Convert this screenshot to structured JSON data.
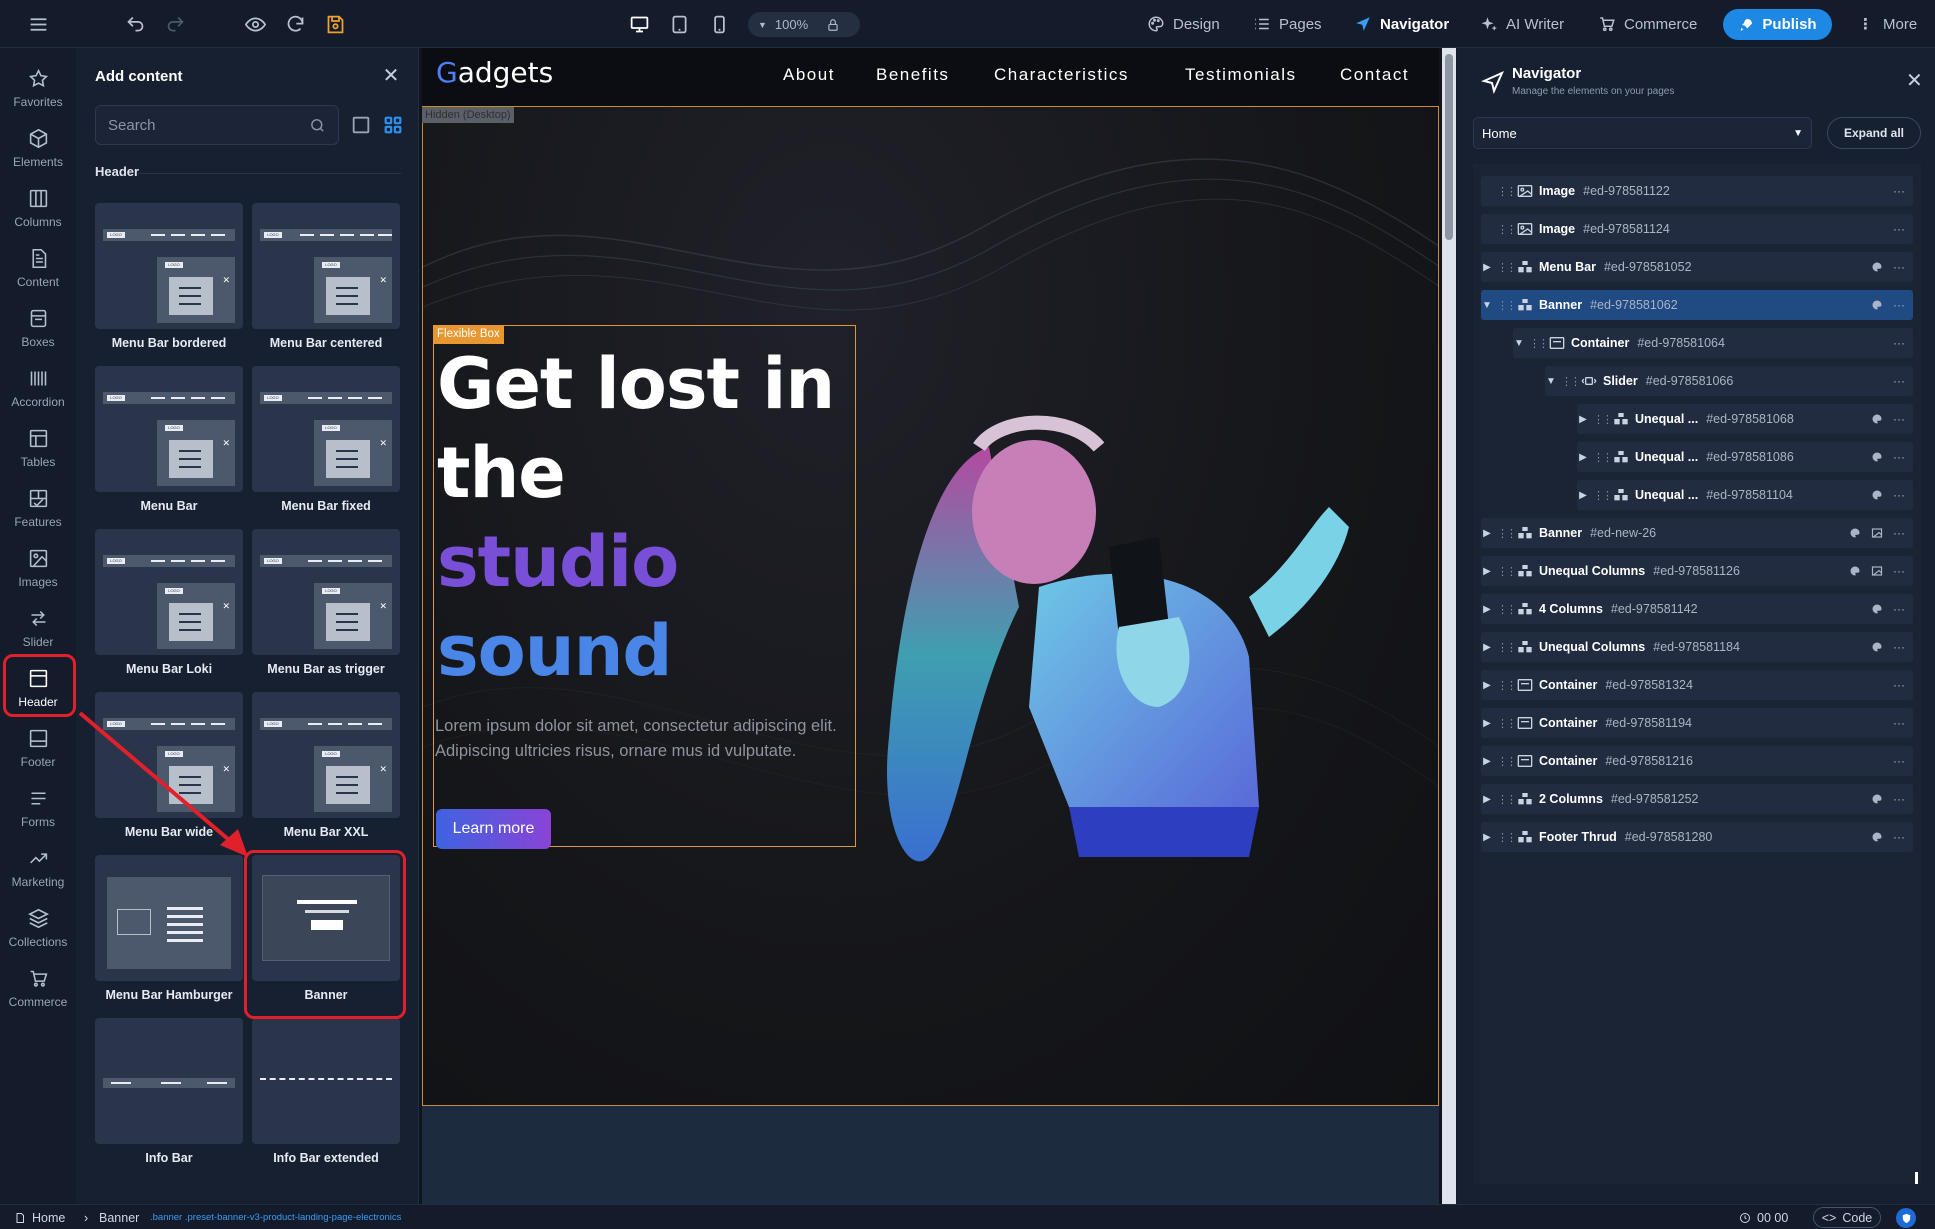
{
  "topbar": {
    "menu_icon": "hamburger-icon",
    "undo_icon": "undo-icon",
    "redo_icon": "redo-icon",
    "preview_icon": "eye-icon",
    "refresh_icon": "refresh-icon",
    "save_icon": "save-icon",
    "zoom": "100%",
    "devices": [
      "desktop",
      "tablet",
      "mobile"
    ],
    "links": [
      {
        "label": "Design",
        "icon": "palette-icon"
      },
      {
        "label": "Pages",
        "icon": "list-icon"
      },
      {
        "label": "Navigator",
        "icon": "navigator-icon",
        "active": true
      },
      {
        "label": "AI Writer",
        "icon": "sparkle-icon"
      },
      {
        "label": "Commerce",
        "icon": "cart-icon"
      }
    ],
    "publish_label": "Publish",
    "more_label": "More"
  },
  "rail": [
    {
      "label": "Favorites",
      "icon": "star-icon"
    },
    {
      "label": "Elements",
      "icon": "cube-icon"
    },
    {
      "label": "Columns",
      "icon": "columns-icon"
    },
    {
      "label": "Content",
      "icon": "document-icon"
    },
    {
      "label": "Boxes",
      "icon": "box-icon"
    },
    {
      "label": "Accordion",
      "icon": "accordion-icon"
    },
    {
      "label": "Tables",
      "icon": "table-icon"
    },
    {
      "label": "Features",
      "icon": "features-icon"
    },
    {
      "label": "Images",
      "icon": "image-icon"
    },
    {
      "label": "Slider",
      "icon": "slider-icon"
    },
    {
      "label": "Header",
      "icon": "header-icon",
      "active": true
    },
    {
      "label": "Footer",
      "icon": "footer-icon"
    },
    {
      "label": "Forms",
      "icon": "forms-icon"
    },
    {
      "label": "Marketing",
      "icon": "trend-icon"
    },
    {
      "label": "Collections",
      "icon": "layers-icon"
    },
    {
      "label": "Commerce",
      "icon": "cart-icon"
    }
  ],
  "add_content": {
    "title": "Add content",
    "search_placeholder": "Search",
    "section": "Header",
    "tiles": [
      "Menu Bar bordered",
      "Menu Bar centered",
      "Menu Bar",
      "Menu Bar fixed",
      "Menu Bar Loki",
      "Menu Bar as trigger",
      "Menu Bar wide",
      "Menu Bar XXL",
      "Menu Bar Hamburger",
      "Banner",
      "Info Bar",
      "Info Bar extended"
    ],
    "mock_logo_text": "LOGO"
  },
  "canvas": {
    "logo_first": "G",
    "logo_rest": "adgets",
    "menu": [
      "About",
      "Benefits",
      "Characteristics",
      "Testimonials",
      "Contact"
    ],
    "hidden_tag": "Hidden (Desktop)",
    "flex_tag": "Flexible Box",
    "headline_1": "Get lost in",
    "headline_2": "the",
    "headline_3": "studio",
    "headline_4": "sound",
    "paragraph": "Lorem ipsum dolor sit amet, consectetur adipiscing elit. Adipiscing ultricies risus, ornare mus id vulputate.",
    "cta": "Learn more"
  },
  "navigator": {
    "title": "Navigator",
    "subtitle": "Manage the elements on your pages",
    "page_select": "Home",
    "expand_all": "Expand all",
    "rows": [
      {
        "label": "Image",
        "id": "#ed-978581122",
        "level": 0,
        "caret": "",
        "icon": "image"
      },
      {
        "label": "Image",
        "id": "#ed-978581124",
        "level": 0,
        "caret": "",
        "icon": "image"
      },
      {
        "label": "Menu Bar",
        "id": "#ed-978581052",
        "level": 0,
        "caret": "▶",
        "icon": "module",
        "palette": true
      },
      {
        "label": "Banner",
        "id": "#ed-978581062",
        "level": 0,
        "caret": "▼",
        "icon": "module",
        "palette": true,
        "selected": true
      },
      {
        "label": "Container",
        "id": "#ed-978581064",
        "level": 1,
        "caret": "▼",
        "icon": "container"
      },
      {
        "label": "Slider",
        "id": "#ed-978581066",
        "level": 2,
        "caret": "▼",
        "icon": "slider"
      },
      {
        "label": "Unequal ...",
        "id": "#ed-978581068",
        "level": 3,
        "caret": "▶",
        "icon": "module",
        "palette": true
      },
      {
        "label": "Unequal ...",
        "id": "#ed-978581086",
        "level": 3,
        "caret": "▶",
        "icon": "module",
        "palette": true
      },
      {
        "label": "Unequal ...",
        "id": "#ed-978581104",
        "level": 3,
        "caret": "▶",
        "icon": "module",
        "palette": true
      },
      {
        "label": "Banner",
        "id": "#ed-new-26",
        "level": 0,
        "caret": "▶",
        "icon": "module",
        "palette": true,
        "bgimage": true
      },
      {
        "label": "Unequal Columns",
        "id": "#ed-978581126",
        "level": 0,
        "caret": "▶",
        "icon": "module",
        "palette": true,
        "bgimage": true
      },
      {
        "label": "4 Columns",
        "id": "#ed-978581142",
        "level": 0,
        "caret": "▶",
        "icon": "module",
        "palette": true
      },
      {
        "label": "Unequal Columns",
        "id": "#ed-978581184",
        "level": 0,
        "caret": "▶",
        "icon": "module",
        "palette": true
      },
      {
        "label": "Container",
        "id": "#ed-978581324",
        "level": 0,
        "caret": "▶",
        "icon": "container"
      },
      {
        "label": "Container",
        "id": "#ed-978581194",
        "level": 0,
        "caret": "▶",
        "icon": "container"
      },
      {
        "label": "Container",
        "id": "#ed-978581216",
        "level": 0,
        "caret": "▶",
        "icon": "container"
      },
      {
        "label": "2 Columns",
        "id": "#ed-978581252",
        "level": 0,
        "caret": "▶",
        "icon": "module",
        "palette": true
      },
      {
        "label": "Footer Thrud",
        "id": "#ed-978581280",
        "level": 0,
        "caret": "▶",
        "icon": "module",
        "palette": true
      }
    ],
    "more_glyph": "···"
  },
  "status": {
    "home": "Home",
    "element": "Banner",
    "classes": ".banner .preset-banner-v3-product-landing-page-electronics",
    "timer": "00 00",
    "code": "Code"
  },
  "colors": {
    "accent": "#1e88e5",
    "highlight": "#e0202a",
    "selection": "#d99a3d"
  }
}
